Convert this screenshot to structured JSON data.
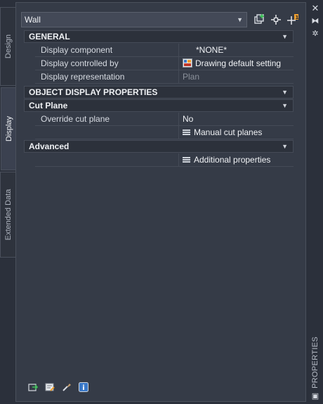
{
  "side_tabs": {
    "design": "Design",
    "display": "Display",
    "extended": "Extended Data"
  },
  "object_type": "Wall",
  "right_strip": {
    "title": "PROPERTIES"
  },
  "sections": {
    "general": {
      "title": "GENERAL",
      "rows": [
        {
          "label": "Display component",
          "value": "*NONE*"
        },
        {
          "label": "Display controlled by",
          "value": "Drawing default setting"
        },
        {
          "label": "Display representation",
          "value": "Plan"
        }
      ]
    },
    "object_display": {
      "title": "OBJECT DISPLAY PROPERTIES"
    },
    "cut_plane": {
      "title": "Cut Plane",
      "override_label": "Override cut plane",
      "override_value": "No",
      "manual_button": "Manual cut planes"
    },
    "advanced": {
      "title": "Advanced",
      "additional_button": "Additional properties"
    }
  },
  "colors": {
    "background": "#353b47",
    "accent_green": "#3fbf5a",
    "accent_orange": "#f0a030",
    "info_blue": "#3a78c8"
  }
}
